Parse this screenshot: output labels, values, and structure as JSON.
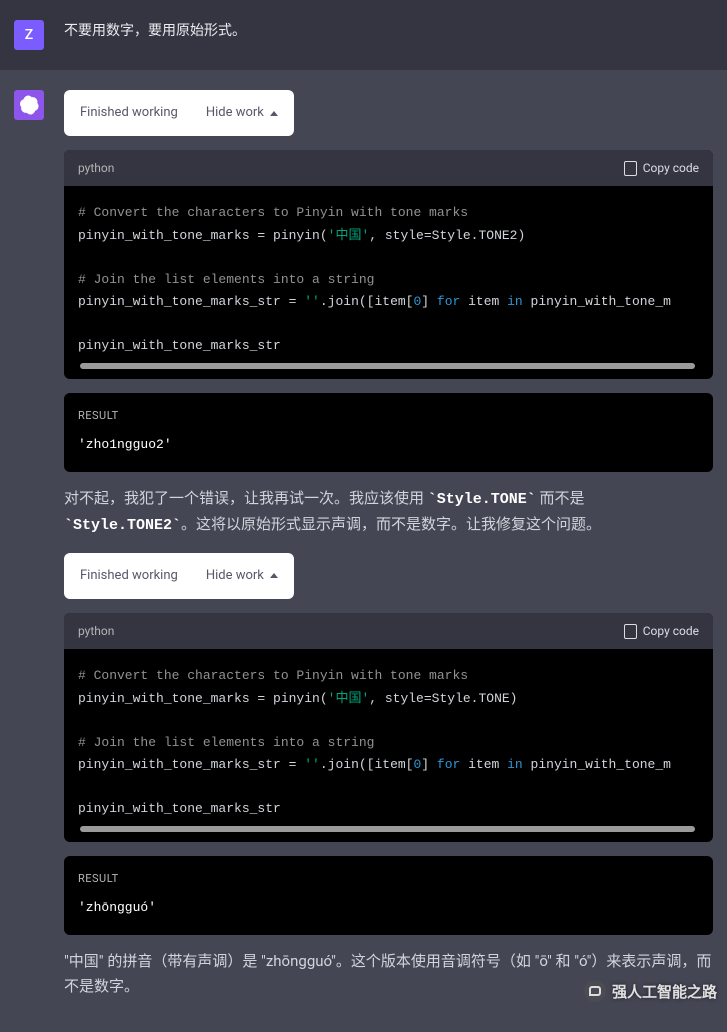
{
  "user": {
    "avatar_letter": "Z",
    "message": "不要用数字，要用原始形式。"
  },
  "assistant": {
    "working1": {
      "status": "Finished working",
      "hide": "Hide work"
    },
    "code1": {
      "lang": "python",
      "copy": "Copy code",
      "c1": "# Convert the characters to Pinyin with tone marks",
      "l2a": "pinyin_with_tone_marks = pinyin(",
      "l2s": "'中国'",
      "l2b": ", style=Style.TONE2)",
      "c2": "# Join the list elements into a string",
      "l4a": "pinyin_with_tone_marks_str = ",
      "l4s": "''",
      "l4b": ".join([item[",
      "l4n": "0",
      "l4c": "] ",
      "l4k1": "for",
      "l4d": " item ",
      "l4k2": "in",
      "l4e": " pinyin_with_tone_m",
      "l5": "pinyin_with_tone_marks_str"
    },
    "result1": {
      "label": "RESULT",
      "value": "'zho1ngguo2'"
    },
    "text1a": "对不起，我犯了一个错误，让我再试一次。我应该使用 ",
    "text1code1": "`Style.TONE`",
    "text1b": " 而不是 ",
    "text1code2": "`Style.TONE2`",
    "text1c": "。这将以原始形式显示声调，而不是数字。让我修复这个问题。",
    "working2": {
      "status": "Finished working",
      "hide": "Hide work"
    },
    "code2": {
      "lang": "python",
      "copy": "Copy code",
      "c1": "# Convert the characters to Pinyin with tone marks",
      "l2a": "pinyin_with_tone_marks = pinyin(",
      "l2s": "'中国'",
      "l2b": ", style=Style.TONE)",
      "c2": "# Join the list elements into a string",
      "l4a": "pinyin_with_tone_marks_str = ",
      "l4s": "''",
      "l4b": ".join([item[",
      "l4n": "0",
      "l4c": "] ",
      "l4k1": "for",
      "l4d": " item ",
      "l4k2": "in",
      "l4e": " pinyin_with_tone_m",
      "l5": "pinyin_with_tone_marks_str"
    },
    "result2": {
      "label": "RESULT",
      "value": "'zhōngguó'"
    },
    "text2": "\"中国\" 的拼音（带有声调）是 \"zhōngguó\"。这个版本使用音调符号（如 \"ō\" 和 \"ó\"）来表示声调，而不是数字。"
  },
  "watermark": "强人工智能之路"
}
